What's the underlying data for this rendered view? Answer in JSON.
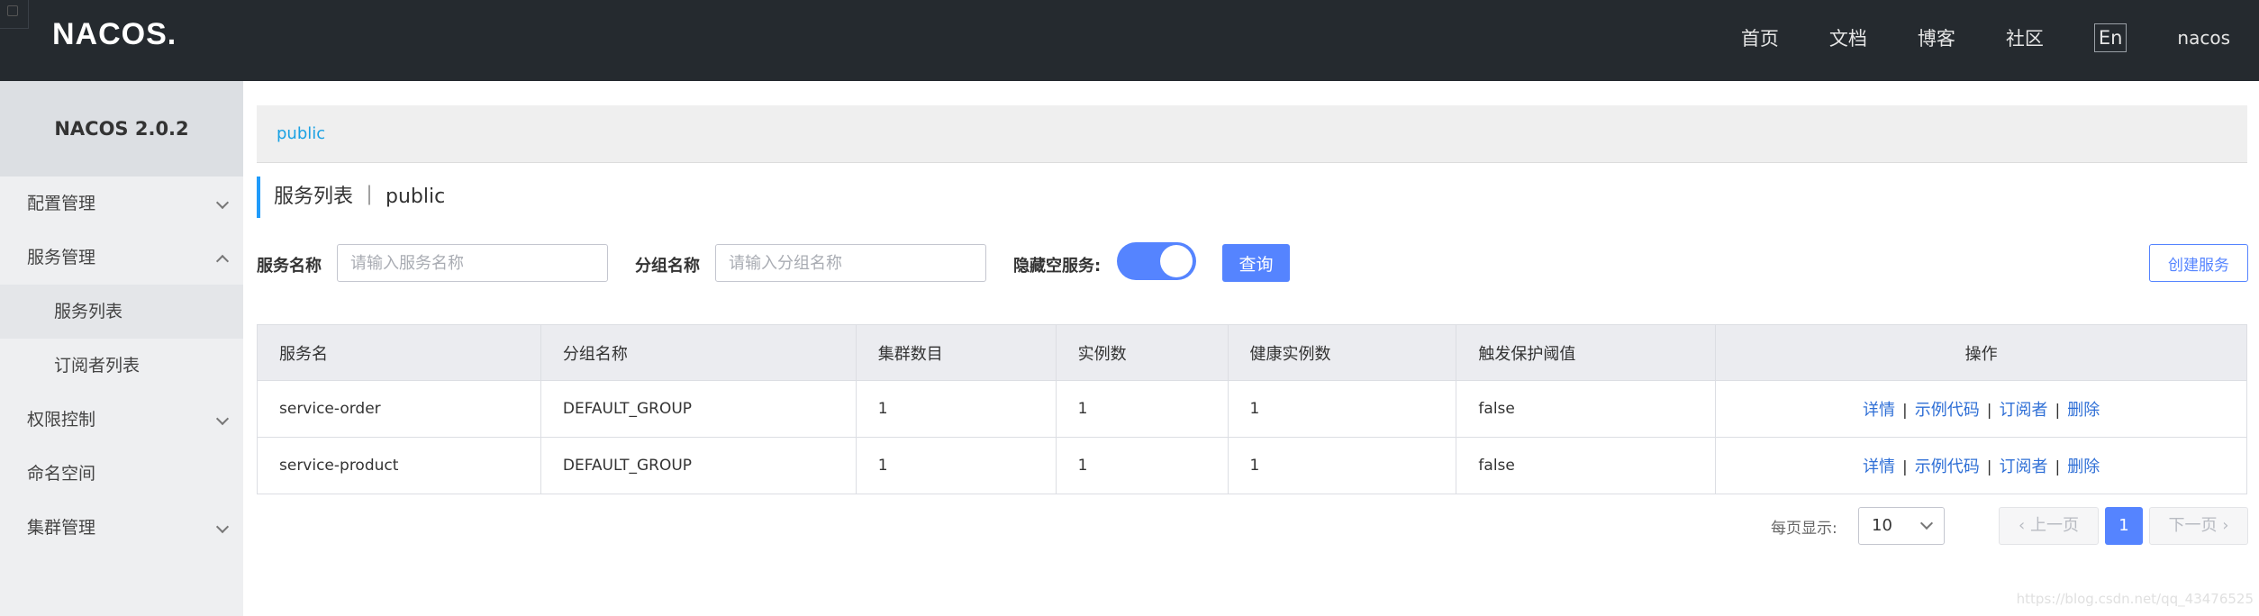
{
  "header": {
    "logo": "NACOS.",
    "nav": [
      "首页",
      "文档",
      "博客",
      "社区"
    ],
    "lang": "En",
    "user": "nacos"
  },
  "sidebar": {
    "title": "NACOS 2.0.2",
    "items": [
      {
        "label": "配置管理"
      },
      {
        "label": "服务管理"
      },
      {
        "label": "服务列表"
      },
      {
        "label": "订阅者列表"
      },
      {
        "label": "权限控制"
      },
      {
        "label": "命名空间"
      },
      {
        "label": "集群管理"
      }
    ]
  },
  "breadcrumb": "public",
  "page_title": "服务列表 ｜ public",
  "filters": {
    "service_name_label": "服务名称",
    "service_name_placeholder": "请输入服务名称",
    "group_name_label": "分组名称",
    "group_name_placeholder": "请输入分组名称",
    "hide_empty_label": "隐藏空服务:",
    "hide_empty_on": true,
    "query_button": "查询",
    "create_button": "创建服务"
  },
  "table": {
    "columns": [
      "服务名",
      "分组名称",
      "集群数目",
      "实例数",
      "健康实例数",
      "触发保护阈值",
      "操作"
    ],
    "rows": [
      {
        "name": "service-order",
        "group": "DEFAULT_GROUP",
        "clusters": "1",
        "instances": "1",
        "healthy": "1",
        "protect": "false"
      },
      {
        "name": "service-product",
        "group": "DEFAULT_GROUP",
        "clusters": "1",
        "instances": "1",
        "healthy": "1",
        "protect": "false"
      }
    ],
    "ops": [
      "详情",
      "示例代码",
      "订阅者",
      "删除"
    ]
  },
  "pagination": {
    "page_size_label": "每页显示:",
    "page_size": "10",
    "prev": "上一页",
    "current": "1",
    "next": "下一页"
  },
  "watermark": "https://blog.csdn.net/qq_43476525",
  "colors": {
    "accent": "#5584ff",
    "topbar": "#252a2f",
    "link": "#2f6fd6"
  }
}
